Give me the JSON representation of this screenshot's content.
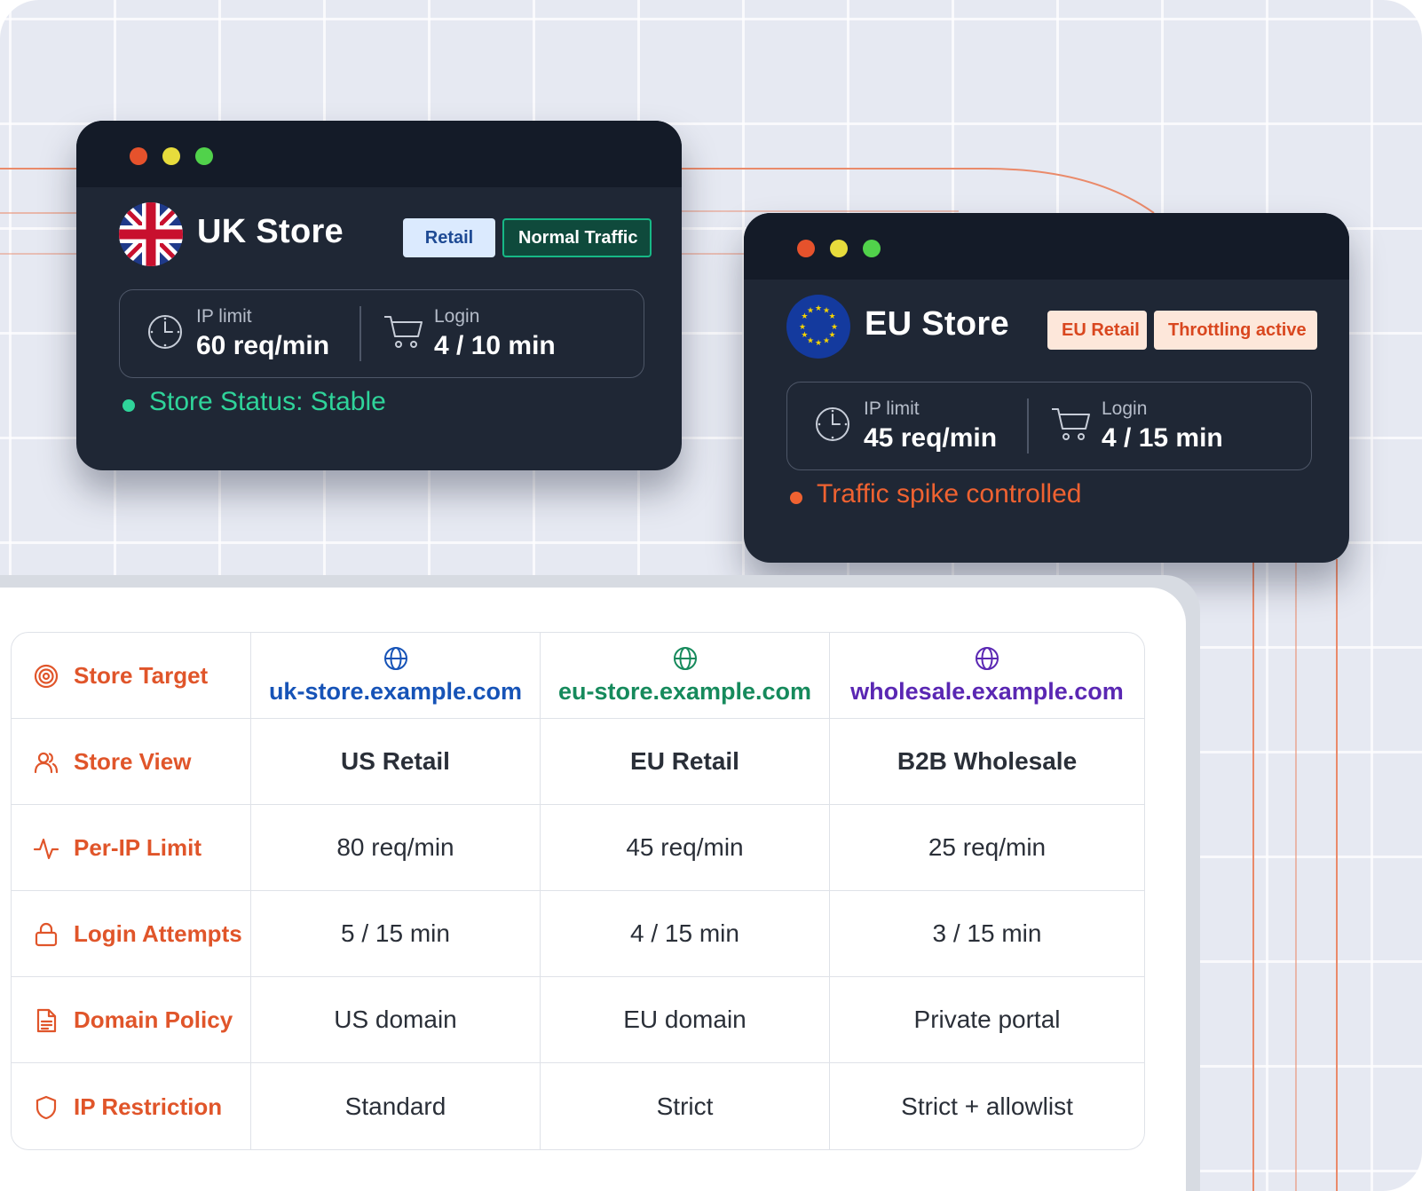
{
  "colors": {
    "accent": "#e0552a",
    "stable": "#2fd49a",
    "alert": "#ef6231",
    "domain_uk": "#1653b7",
    "domain_eu": "#168a5c",
    "domain_wholesale": "#5a27b3"
  },
  "uk_store": {
    "name": "UK Store",
    "flag_icon": "uk-flag",
    "tags": [
      "Retail",
      "Normal Traffic"
    ],
    "ip_label": "IP limit",
    "ip_value": "60 req/min",
    "login_label": "Login",
    "login_value": "4 / 10 min",
    "status": "Store Status: Stable"
  },
  "eu_store": {
    "name": "EU Store",
    "flag_icon": "eu-flag",
    "tags": [
      "EU Retail",
      "Throttling active"
    ],
    "ip_label": "IP limit",
    "ip_value": "45 req/min",
    "login_label": "Login",
    "login_value": "4 / 15 min",
    "status": "Traffic spike controlled"
  },
  "table": {
    "domains": [
      "uk-store.example.com",
      "eu-store.example.com",
      "wholesale.example.com"
    ],
    "rows": [
      {
        "label": "Store Target",
        "icon": "target-icon"
      },
      {
        "label": "Store View",
        "icon": "users-icon",
        "values": [
          "US Retail",
          "EU Retail",
          "B2B Wholesale"
        ]
      },
      {
        "label": "Per-IP Limit",
        "icon": "activity-icon",
        "values": [
          "80 req/min",
          "45 req/min",
          "25 req/min"
        ]
      },
      {
        "label": "Login Attempts",
        "icon": "lock-icon",
        "values": [
          "5 / 15 min",
          "4 / 15 min",
          "3 / 15 min"
        ]
      },
      {
        "label": "Domain Policy",
        "icon": "document-icon",
        "values": [
          "US domain",
          "EU domain",
          "Private portal"
        ]
      },
      {
        "label": "IP Restriction",
        "icon": "shield-icon",
        "values": [
          "Standard",
          "Strict",
          "Strict + allowlist"
        ]
      }
    ]
  }
}
